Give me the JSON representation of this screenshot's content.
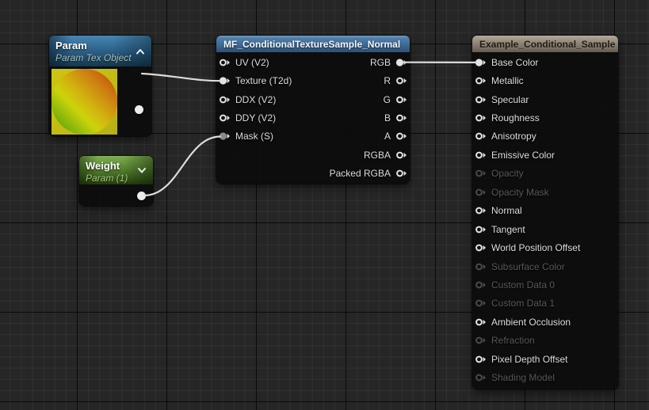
{
  "colors": {
    "background": "#262626",
    "wire": "#dcdcdc",
    "param_header_accent": "#2f648c",
    "weight_header_accent": "#5d8b34",
    "function_header_accent": "#3e6b97",
    "result_header_accent": "#93897b",
    "texture_preview": [
      "#3f9d07",
      "#cbd40a",
      "#c33b0e"
    ]
  },
  "nodes": {
    "param": {
      "title": "Param",
      "subtitle": "Param Tex Object",
      "collapse_icon": "chevron-up",
      "preview": "texture-thumbnail-green-yellow-red-sphere",
      "outputs": [
        {
          "label": "",
          "connected": true
        }
      ]
    },
    "weight": {
      "title": "Weight",
      "subtitle": "Param (1)",
      "collapse_icon": "chevron-down",
      "outputs": [
        {
          "label": "",
          "connected": true
        }
      ]
    },
    "function": {
      "title": "MF_ConditionalTextureSample_Normal",
      "inputs": [
        {
          "label": "UV (V2)",
          "connected": false
        },
        {
          "label": "Texture (T2d)",
          "connected": true
        },
        {
          "label": "DDX (V2)",
          "connected": false
        },
        {
          "label": "DDY (V2)",
          "connected": false
        },
        {
          "label": "Mask (S)",
          "connected": true,
          "fill": "#8a8a8a"
        }
      ],
      "outputs": [
        {
          "label": "RGB",
          "connected": true
        },
        {
          "label": "R",
          "connected": false
        },
        {
          "label": "G",
          "connected": false
        },
        {
          "label": "B",
          "connected": false
        },
        {
          "label": "A",
          "connected": false
        },
        {
          "label": "RGBA",
          "connected": false
        },
        {
          "label": "Packed RGBA",
          "connected": false
        }
      ]
    },
    "result": {
      "title": "Example_Conditional_Sample",
      "inputs": [
        {
          "label": "Base Color",
          "enabled": true,
          "connected": true
        },
        {
          "label": "Metallic",
          "enabled": true
        },
        {
          "label": "Specular",
          "enabled": true
        },
        {
          "label": "Roughness",
          "enabled": true
        },
        {
          "label": "Anisotropy",
          "enabled": true
        },
        {
          "label": "Emissive Color",
          "enabled": true
        },
        {
          "label": "Opacity",
          "enabled": false
        },
        {
          "label": "Opacity Mask",
          "enabled": false
        },
        {
          "label": "Normal",
          "enabled": true
        },
        {
          "label": "Tangent",
          "enabled": true
        },
        {
          "label": "World Position Offset",
          "enabled": true
        },
        {
          "label": "Subsurface Color",
          "enabled": false
        },
        {
          "label": "Custom Data 0",
          "enabled": false
        },
        {
          "label": "Custom Data 1",
          "enabled": false
        },
        {
          "label": "Ambient Occlusion",
          "enabled": true
        },
        {
          "label": "Refraction",
          "enabled": false
        },
        {
          "label": "Pixel Depth Offset",
          "enabled": true
        },
        {
          "label": "Shading Model",
          "enabled": false
        }
      ]
    }
  },
  "wires": [
    {
      "from": "Param.output",
      "to": "MF_ConditionalTextureSample_Normal.Texture (T2d)"
    },
    {
      "from": "Weight.output",
      "to": "MF_ConditionalTextureSample_Normal.Mask (S)"
    },
    {
      "from": "MF_ConditionalTextureSample_Normal.RGB",
      "to": "Example_Conditional_Sample.Base Color"
    }
  ]
}
